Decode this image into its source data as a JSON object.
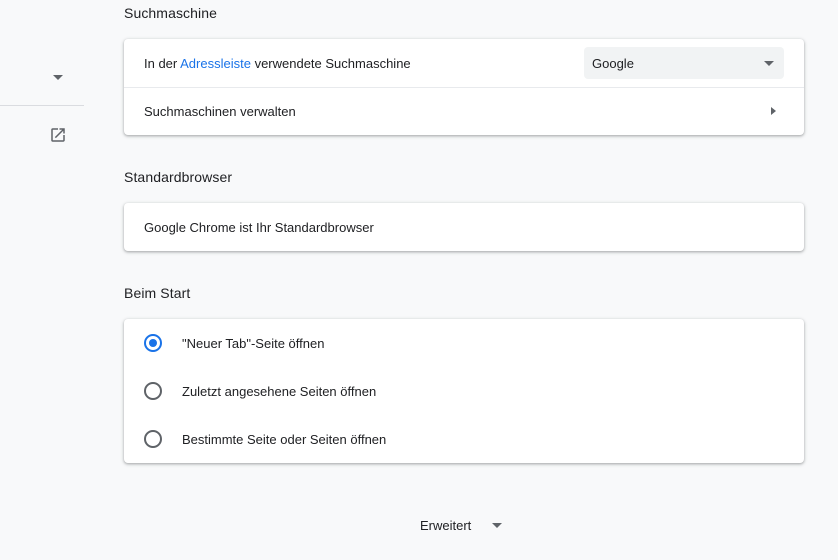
{
  "search_engine": {
    "section_title": "Suchmaschine",
    "address_bar_row": {
      "prefix": "In der ",
      "link": "Adressleiste",
      "suffix": " verwendete Suchmaschine"
    },
    "selected_engine": "Google",
    "manage_label": "Suchmaschinen verwalten"
  },
  "default_browser": {
    "section_title": "Standardbrowser",
    "status": "Google Chrome ist Ihr Standardbrowser"
  },
  "on_startup": {
    "section_title": "Beim Start",
    "options": [
      {
        "label": "\"Neuer Tab\"-Seite öffnen",
        "checked": true
      },
      {
        "label": "Zuletzt angesehene Seiten öffnen",
        "checked": false
      },
      {
        "label": "Bestimmte Seite oder Seiten öffnen",
        "checked": false
      }
    ]
  },
  "advanced": {
    "label": "Erweitert"
  },
  "colors": {
    "accent": "#1a73e8",
    "background": "#f8f9fa",
    "card": "#ffffff",
    "icon": "#5f6368"
  },
  "icons": {
    "sidebar_dropdown": "chevron-down-icon",
    "sidebar_external": "open-in-new-icon",
    "select": "caret-down-icon",
    "submenu": "caret-right-icon",
    "advanced": "caret-down-icon"
  }
}
